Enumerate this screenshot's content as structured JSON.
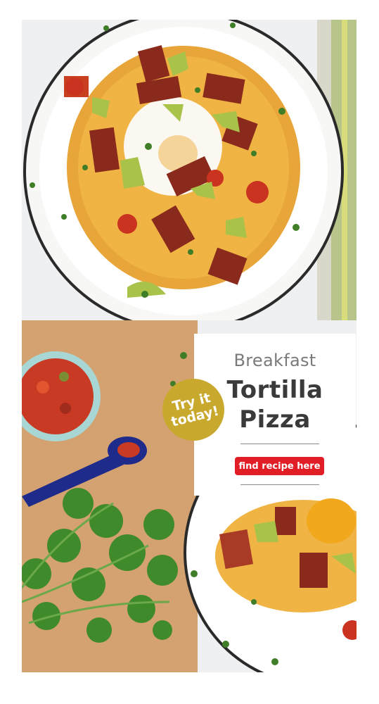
{
  "promo": {
    "title_small": "Breakfast",
    "title_line1": "Tortilla",
    "title_line2": "Pizza",
    "cta_label": "find recipe here"
  },
  "badge": {
    "line1": "Try it",
    "line2": "today!"
  },
  "colors": {
    "cta": "#e11e26",
    "badge": "#c9a82e"
  }
}
